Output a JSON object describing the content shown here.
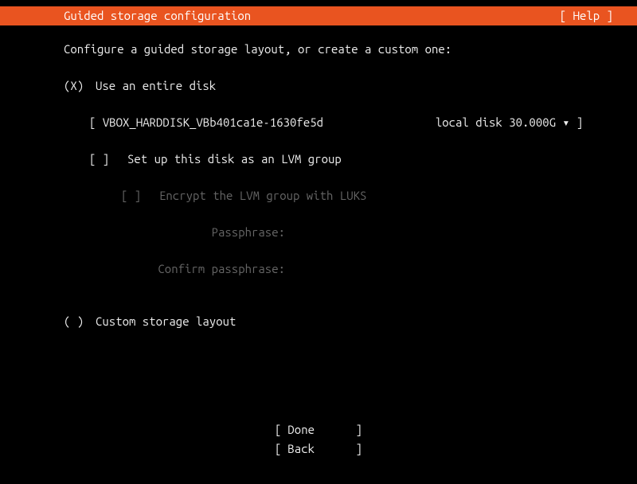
{
  "header": {
    "title": "Guided storage configuration",
    "help": "[ Help ]"
  },
  "intro": "Configure a guided storage layout, or create a custom one:",
  "options": {
    "entire_disk": {
      "mark": "(X)",
      "label": "Use an entire disk"
    },
    "custom": {
      "mark": "( )",
      "label": "Custom storage layout"
    }
  },
  "disk": {
    "open": "[",
    "name": "VBOX_HARDDISK_VBb401ca1e-1630fe5d",
    "desc": "local disk 30.000G",
    "arrow": "▾",
    "close": "]"
  },
  "lvm": {
    "mark": "[ ]",
    "label": "Set up this disk as an LVM group"
  },
  "luks": {
    "mark": "[ ]",
    "label": "Encrypt the LVM group with LUKS"
  },
  "passphrase": {
    "label": "Passphrase:",
    "value": ""
  },
  "confirm": {
    "label": "Confirm passphrase:",
    "value": ""
  },
  "footer": {
    "done": "Done",
    "back": "Back"
  }
}
